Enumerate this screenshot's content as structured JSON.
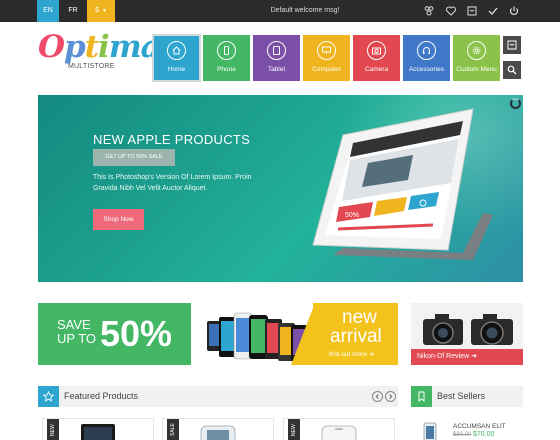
{
  "topbar": {
    "languages": [
      "EN",
      "FR"
    ],
    "currency": "$",
    "welcome": "Default welcome msg!",
    "icons": [
      "users-icon",
      "heart-icon",
      "cart-icon",
      "check-icon",
      "power-icon"
    ]
  },
  "logo": {
    "text_parts": [
      "O",
      "p",
      "t",
      "i",
      "ma"
    ],
    "subtitle": "MULTISTORE"
  },
  "nav": {
    "tiles": [
      {
        "label": "Home",
        "icon": "home-icon",
        "color": "#2da5ce"
      },
      {
        "label": "Phone",
        "icon": "phone-icon",
        "color": "#43b764"
      },
      {
        "label": "Tablet",
        "icon": "tablet-icon",
        "color": "#7b4fa8"
      },
      {
        "label": "Computer",
        "icon": "monitor-icon",
        "color": "#f0b41f"
      },
      {
        "label": "Camera",
        "icon": "camera-icon",
        "color": "#e2484f"
      },
      {
        "label": "Accessories",
        "icon": "headphones-icon",
        "color": "#3f78c9"
      },
      {
        "label": "Custom Menu",
        "icon": "gear-icon",
        "color": "#8bc34a"
      }
    ],
    "cart_icon": "cart-icon",
    "search_icon": "search-icon"
  },
  "hero": {
    "title": "NEW APPLE PRODUCTS",
    "sale_label": "GET UP TO 50% SALE",
    "description": "This Is Photoshop's Version Of Lorem Ipsum. Proin Gravida Nibh Vel Velit Auctor Aliquet.",
    "button": "Shop Now",
    "tablet_tiles": [
      {
        "label": "50%",
        "color": "#e2484f"
      },
      {
        "label": "",
        "color": "#f0b41f"
      },
      {
        "label": "",
        "color": "#2da5ce"
      }
    ]
  },
  "promos": {
    "save": {
      "line1": "SAVE",
      "line2": "UP TO",
      "percent": "50%"
    },
    "new_arrival": {
      "line1": "new",
      "line2": "arrival",
      "link": "find out more"
    },
    "camera": {
      "label": "Nikon-Df Review"
    }
  },
  "featured": {
    "title": "Featured Products",
    "icon": "star-icon",
    "cards": [
      {
        "ribbon": "NEW"
      },
      {
        "ribbon": "SALE"
      },
      {
        "ribbon": "NEW"
      }
    ]
  },
  "best_sellers": {
    "title": "Best Sellers",
    "icon": "bookmark-icon",
    "item": {
      "name": "ACCUMSAN ELIT",
      "old_price": "$80.00",
      "price": "$70.00"
    }
  },
  "colors": {
    "accent_blue": "#2da5ce",
    "green": "#43b764",
    "yellow": "#f0b41f",
    "red": "#e2484f",
    "dark_bar": "#2b2b2b"
  }
}
